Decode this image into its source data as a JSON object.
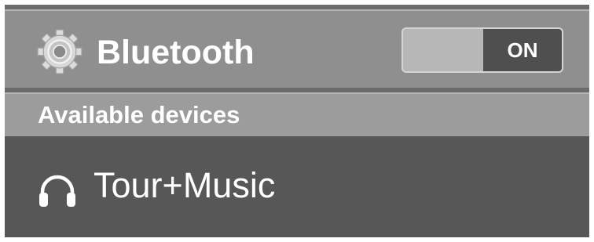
{
  "header": {
    "title": "Bluetooth",
    "icon": "gear-icon",
    "toggle": {
      "state_label": "ON",
      "is_on": true
    }
  },
  "section": {
    "label": "Available devices"
  },
  "devices": [
    {
      "name": "Tour+Music",
      "icon": "headphones-icon"
    }
  ]
}
